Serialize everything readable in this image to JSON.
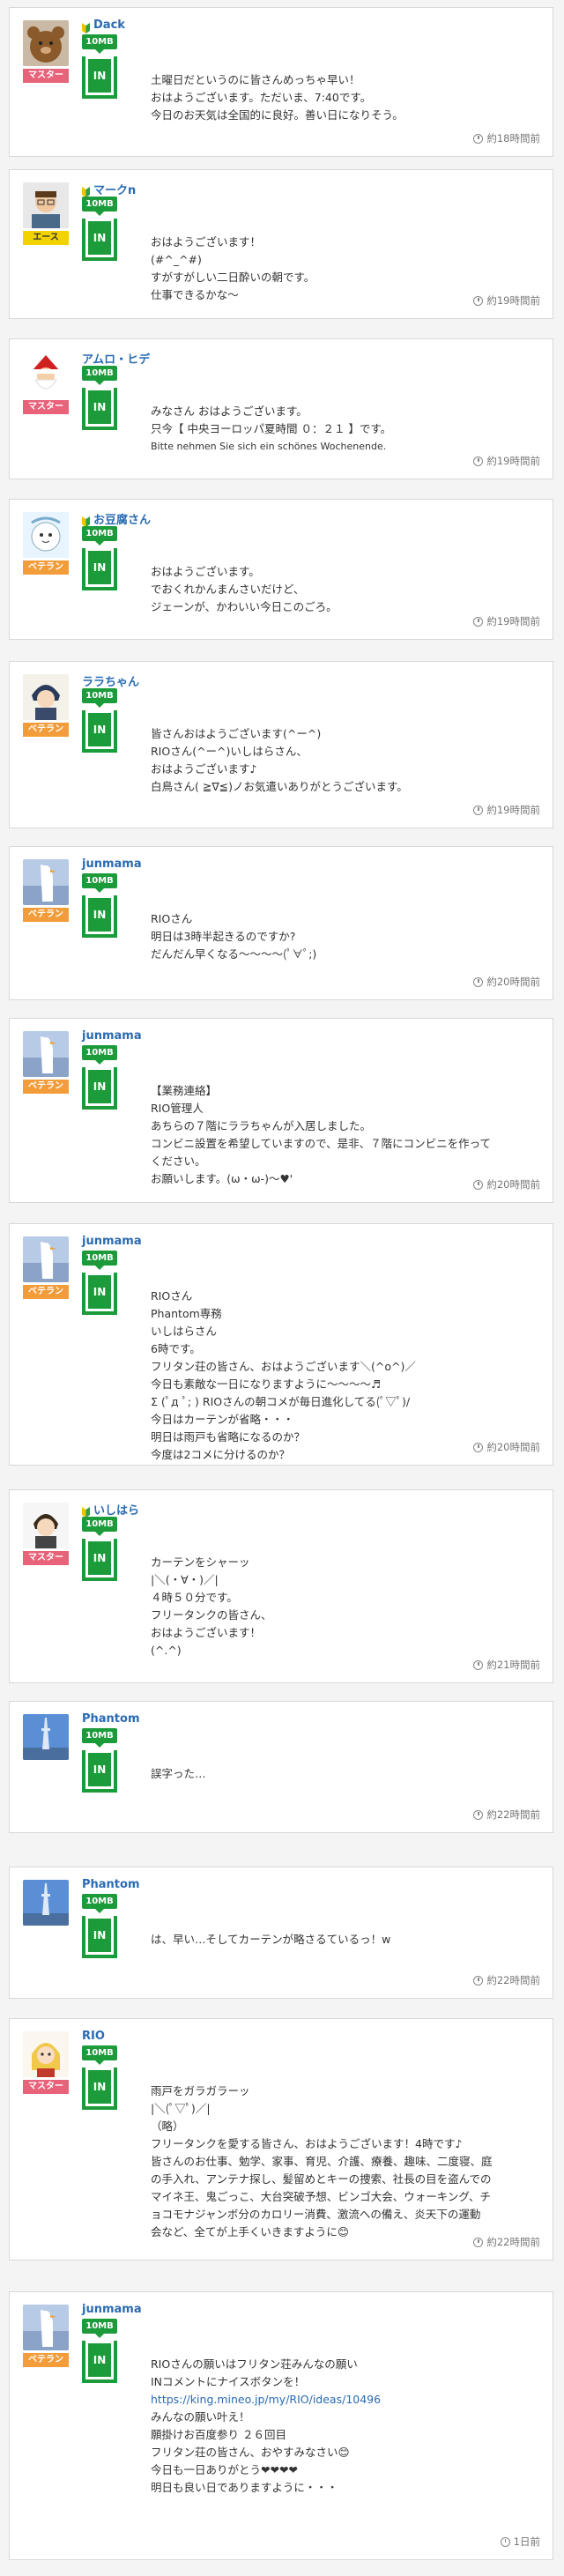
{
  "rank_labels": {
    "master": "マスター",
    "ace": "エース",
    "veteran": "ベテラン"
  },
  "speed_label": "10MB",
  "in_label": "IN",
  "posts": [
    {
      "name": "Dack",
      "beginner": true,
      "rank": "マスター",
      "rank_type": "master",
      "avatar": "teddy-bear",
      "lines": [
        "土曜日だというのに皆さんめっちゃ早い！",
        "おはようございます。ただいま、7:40です。",
        "今日のお天気は全国的に良好。善い日になりそう。"
      ],
      "time": "約18時間前"
    },
    {
      "name": "マークn",
      "beginner": true,
      "rank": "エース",
      "rank_type": "ace",
      "avatar": "man-glasses",
      "lines": [
        "おはようございます！",
        "(#^_^#)",
        "すがすがしい二日酔いの朝です。",
        "仕事できるかな〜"
      ],
      "time": "約19時間前"
    },
    {
      "name": "アムロ・ヒデ",
      "beginner": false,
      "rank": "マスター",
      "rank_type": "master",
      "avatar": "santa",
      "lines": [
        "みなさん おはようございます。",
        "只今【 中央ヨーロッパ夏時間 ０：２１ 】です。",
        "Bitte nehmen Sie sich ein schönes Wochenende."
      ],
      "time": "約19時間前"
    },
    {
      "name": "お豆腐さん",
      "beginner": true,
      "rank": "ベテラン",
      "rank_type": "veteran",
      "avatar": "tofu-character",
      "lines": [
        "おはようございます。",
        "でおくれかんまんさいだけど、",
        "ジェーンが、かわいい今日このごろ。"
      ],
      "time": "約19時間前"
    },
    {
      "name": "ララちゃん",
      "beginner": false,
      "rank": "ベテラン",
      "rank_type": "veteran",
      "avatar": "anime-boy",
      "lines": [
        "皆さんおはようございます(^ー^)",
        "RIOさん(^ー^)いしはらさん、",
        "おはようございます♪",
        "白鳥さん( ≧∇≦)ノお気遣いありがとうございます。"
      ],
      "time": "約19時間前"
    },
    {
      "name": "junmama",
      "beginner": false,
      "rank": "ベテラン",
      "rank_type": "veteran",
      "avatar": "white-bird",
      "lines": [
        "RIOさん",
        "明日は3時半起きるのですか?",
        "だんだん早くなる〜〜〜〜(ﾟ∀ﾟ;)"
      ],
      "time": "約20時間前"
    },
    {
      "name": "junmama",
      "beginner": false,
      "rank": "ベテラン",
      "rank_type": "veteran",
      "avatar": "white-bird",
      "lines": [
        "【業務連絡】",
        "RIO管理人",
        "あちらの７階にララちゃんが入居しました。",
        "コンビニ設置を希望していますので、是非、７階にコンビニを作って",
        "ください。",
        "お願いします。(ω・ω-)〜♥'"
      ],
      "time": "約20時間前"
    },
    {
      "name": "junmama",
      "beginner": false,
      "rank": "ベテラン",
      "rank_type": "veteran",
      "avatar": "white-bird",
      "lines": [
        "RIOさん",
        "Phantom専務",
        "いしはらさん",
        "6時です。",
        "フリタン荘の皆さん、おはようございます＼(^o^)／",
        "今日も素敵な一日になりますように〜〜〜〜♬",
        "Σ (ﾟд ﾟ; ) RIOさんの朝コメが毎日進化してる(ﾟ▽ﾟ)/",
        "今日はカーテンが省略・・・",
        "明日は雨戸も省略になるのか？",
        "今度は2コメに分けるのか？"
      ],
      "time": "約20時間前"
    },
    {
      "name": "いしはら",
      "beginner": true,
      "rank": "マスター",
      "rank_type": "master",
      "avatar": "anime-man",
      "lines": [
        "カーテンをシャーッ",
        "|＼(・∀・)／|",
        "４時５０分です。",
        "フリータンクの皆さん、",
        "おはようございます！",
        "(^.^)"
      ],
      "time": "約21時間前"
    },
    {
      "name": "Phantom",
      "beginner": false,
      "rank": "",
      "rank_type": "none",
      "avatar": "tower",
      "lines": [
        "誤字った…"
      ],
      "time": "約22時間前"
    },
    {
      "name": "Phantom",
      "beginner": false,
      "rank": "",
      "rank_type": "none",
      "avatar": "tower",
      "lines": [
        "は、早い…そしてカーテンが略さるているっ！w"
      ],
      "time": "約22時間前"
    },
    {
      "name": "RIO",
      "beginner": false,
      "rank": "マスター",
      "rank_type": "master",
      "avatar": "anime-girl",
      "lines": [
        "雨戸をガラガラーッ",
        "|＼(ﾟ▽ﾟ)／|",
        "（略）",
        "フリータンクを愛する皆さん、おはようございます！4時です♪",
        "皆さんのお仕事、勉学、家事、育児、介護、療養、趣味、二度寝、庭",
        "の手入れ、アンテナ探し、髪留めとキーの捜索、社長の目を盗んでの",
        "マイネ王、鬼ごっこ、大台突破予想、ビンゴ大会、ウォーキング、チ",
        "ョコモナジャンボ分のカロリー消費、激流への備え、炎天下の運動",
        "会など、全てが上手くいきますように😊"
      ],
      "time": "約22時間前"
    },
    {
      "name": "junmama",
      "beginner": false,
      "rank": "ベテラン",
      "rank_type": "veteran",
      "avatar": "white-bird",
      "lines": [
        "RIOさんの願いはフリタン荘みんなの願い",
        "INコメントにナイスボタンを！",
        "https://king.mineo.jp/my/RIO/ideas/10496",
        "みんなの願い叶え！",
        "願掛けお百度参り ２６回目",
        "フリタン荘の皆さん、おやすみなさい😊",
        "今日も一日ありがとう❤❤❤❤",
        "明日も良い日でありますように・・・"
      ],
      "time": "1日前"
    }
  ],
  "colors": {
    "brand_green": "#1b9b3a",
    "name_blue": "#2a6bb3",
    "master": "#e8637a",
    "ace": "#f2d200",
    "veteran": "#f39c3a"
  }
}
